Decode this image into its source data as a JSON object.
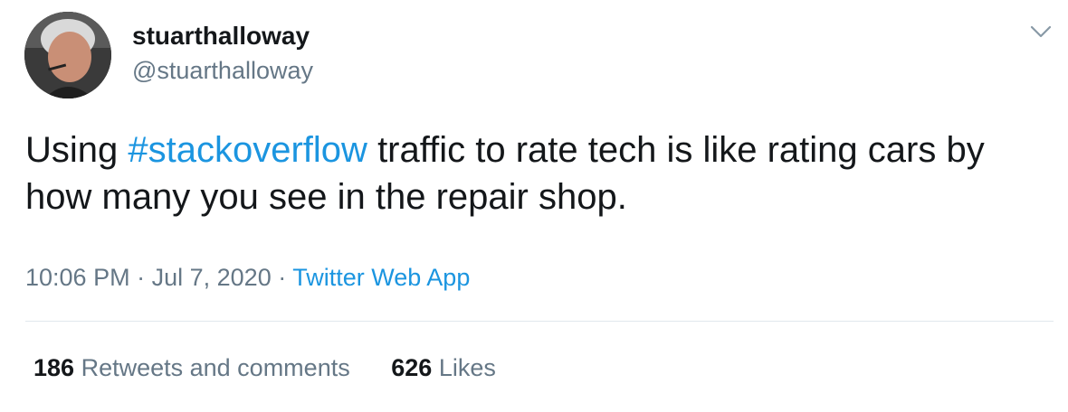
{
  "user": {
    "display_name": "stuarthalloway",
    "handle": "@stuarthalloway"
  },
  "tweet": {
    "text_before": "Using ",
    "hashtag": "#stackoverflow",
    "text_after": " traffic to rate tech is like rating cars by how many you see in the repair shop."
  },
  "meta": {
    "time": "10:06 PM",
    "separator": "·",
    "date": "Jul 7, 2020",
    "source": "Twitter Web App"
  },
  "stats": {
    "retweets_count": "186",
    "retweets_label": "Retweets and comments",
    "likes_count": "626",
    "likes_label": "Likes"
  },
  "icons": {
    "caret": "chevron-down-icon"
  },
  "colors": {
    "link": "#1b95e0",
    "secondary_text": "#657786",
    "primary_text": "#14171a",
    "divider": "#e1e8ed"
  }
}
